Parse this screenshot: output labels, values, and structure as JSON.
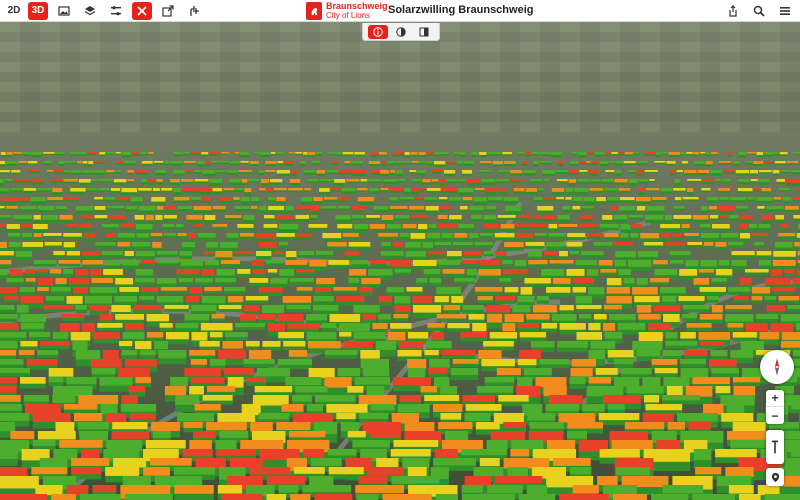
{
  "toolbar": {
    "mode_2d": "2D",
    "mode_3d": "3D",
    "active_mode": "3D",
    "icons": [
      "image-icon",
      "layers-icon",
      "settings-sliders-icon",
      "solar-tool-icon",
      "share-icon",
      "add-point-icon"
    ],
    "active_icon": "solar-tool-icon"
  },
  "brand": {
    "name": "Braunschweig",
    "subtitle": "City of Lions",
    "color": "#e5231b"
  },
  "app": {
    "title": "Solarzwilling Braunschweig"
  },
  "right_icons": [
    "share-upload-icon",
    "search-icon",
    "menu-icon"
  ],
  "subtools": {
    "items": [
      "info-icon",
      "shading-icon",
      "split-view-icon"
    ],
    "active": "info-icon"
  },
  "map_controls": {
    "compass_label": "N",
    "zoom_in": "+",
    "zoom_out": "−"
  },
  "colors": {
    "accent": "#e5231b",
    "solar_high": "#e8412a",
    "solar_mid_high": "#f28c1d",
    "solar_mid": "#e8d21e",
    "solar_low": "#4cae2c"
  }
}
